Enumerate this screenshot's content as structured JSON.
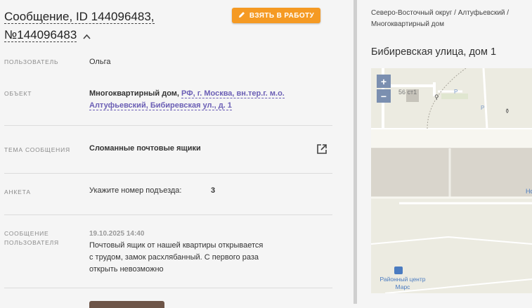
{
  "message": {
    "title_line1": "Сообщение, ID 144096483,",
    "title_line2": "№144096483",
    "take_button": "ВЗЯТЬ В РАБОТУ"
  },
  "fields": {
    "user_label": "ПОЛЬЗОВАТЕЛЬ",
    "user_value": "Ольга",
    "object_label": "ОБЪЕКТ",
    "object_type": "Многоквартирный дом,",
    "object_address_line1": "РФ, г. Москва, вн.тер.г. м.о.",
    "object_address_line2": "Алтуфьевский, Бибиревская ул., д. 1",
    "topic_label": "ТЕМА СООБЩЕНИЯ",
    "topic_value": "Сломанные почтовые ящики",
    "form_label": "АНКЕТА",
    "form_question": "Укажите номер подъезда:",
    "form_answer": "3",
    "msg_label_line1": "СООБЩЕНИЕ",
    "msg_label_line2": "ПОЛЬЗОВАТЕЛЯ",
    "msg_date": "19.10.2025 14:40",
    "msg_line1": "Почтовый ящик от нашей квартиры открывается",
    "msg_line2": "с трудом, замок расхлябанный. С первого раза",
    "msg_line3": "открыть невозможно"
  },
  "sidebar": {
    "breadcrumb_line1": "Северо-Восточный округ / Алтуфьевский /",
    "breadcrumb_line2": "Многоквартирный дом",
    "address": "Бибиревская улица, дом 1"
  },
  "map": {
    "zoom_in": "+",
    "zoom_out": "−",
    "building_label": "56 ст1",
    "parking_label": "P",
    "stop_label_line1": "Районный центр",
    "stop_label_line2": "Марс",
    "edge_label": "Но"
  },
  "colors": {
    "accent": "#f59a23",
    "link": "#6b5fb5",
    "zoom": "#7b8fb0"
  }
}
